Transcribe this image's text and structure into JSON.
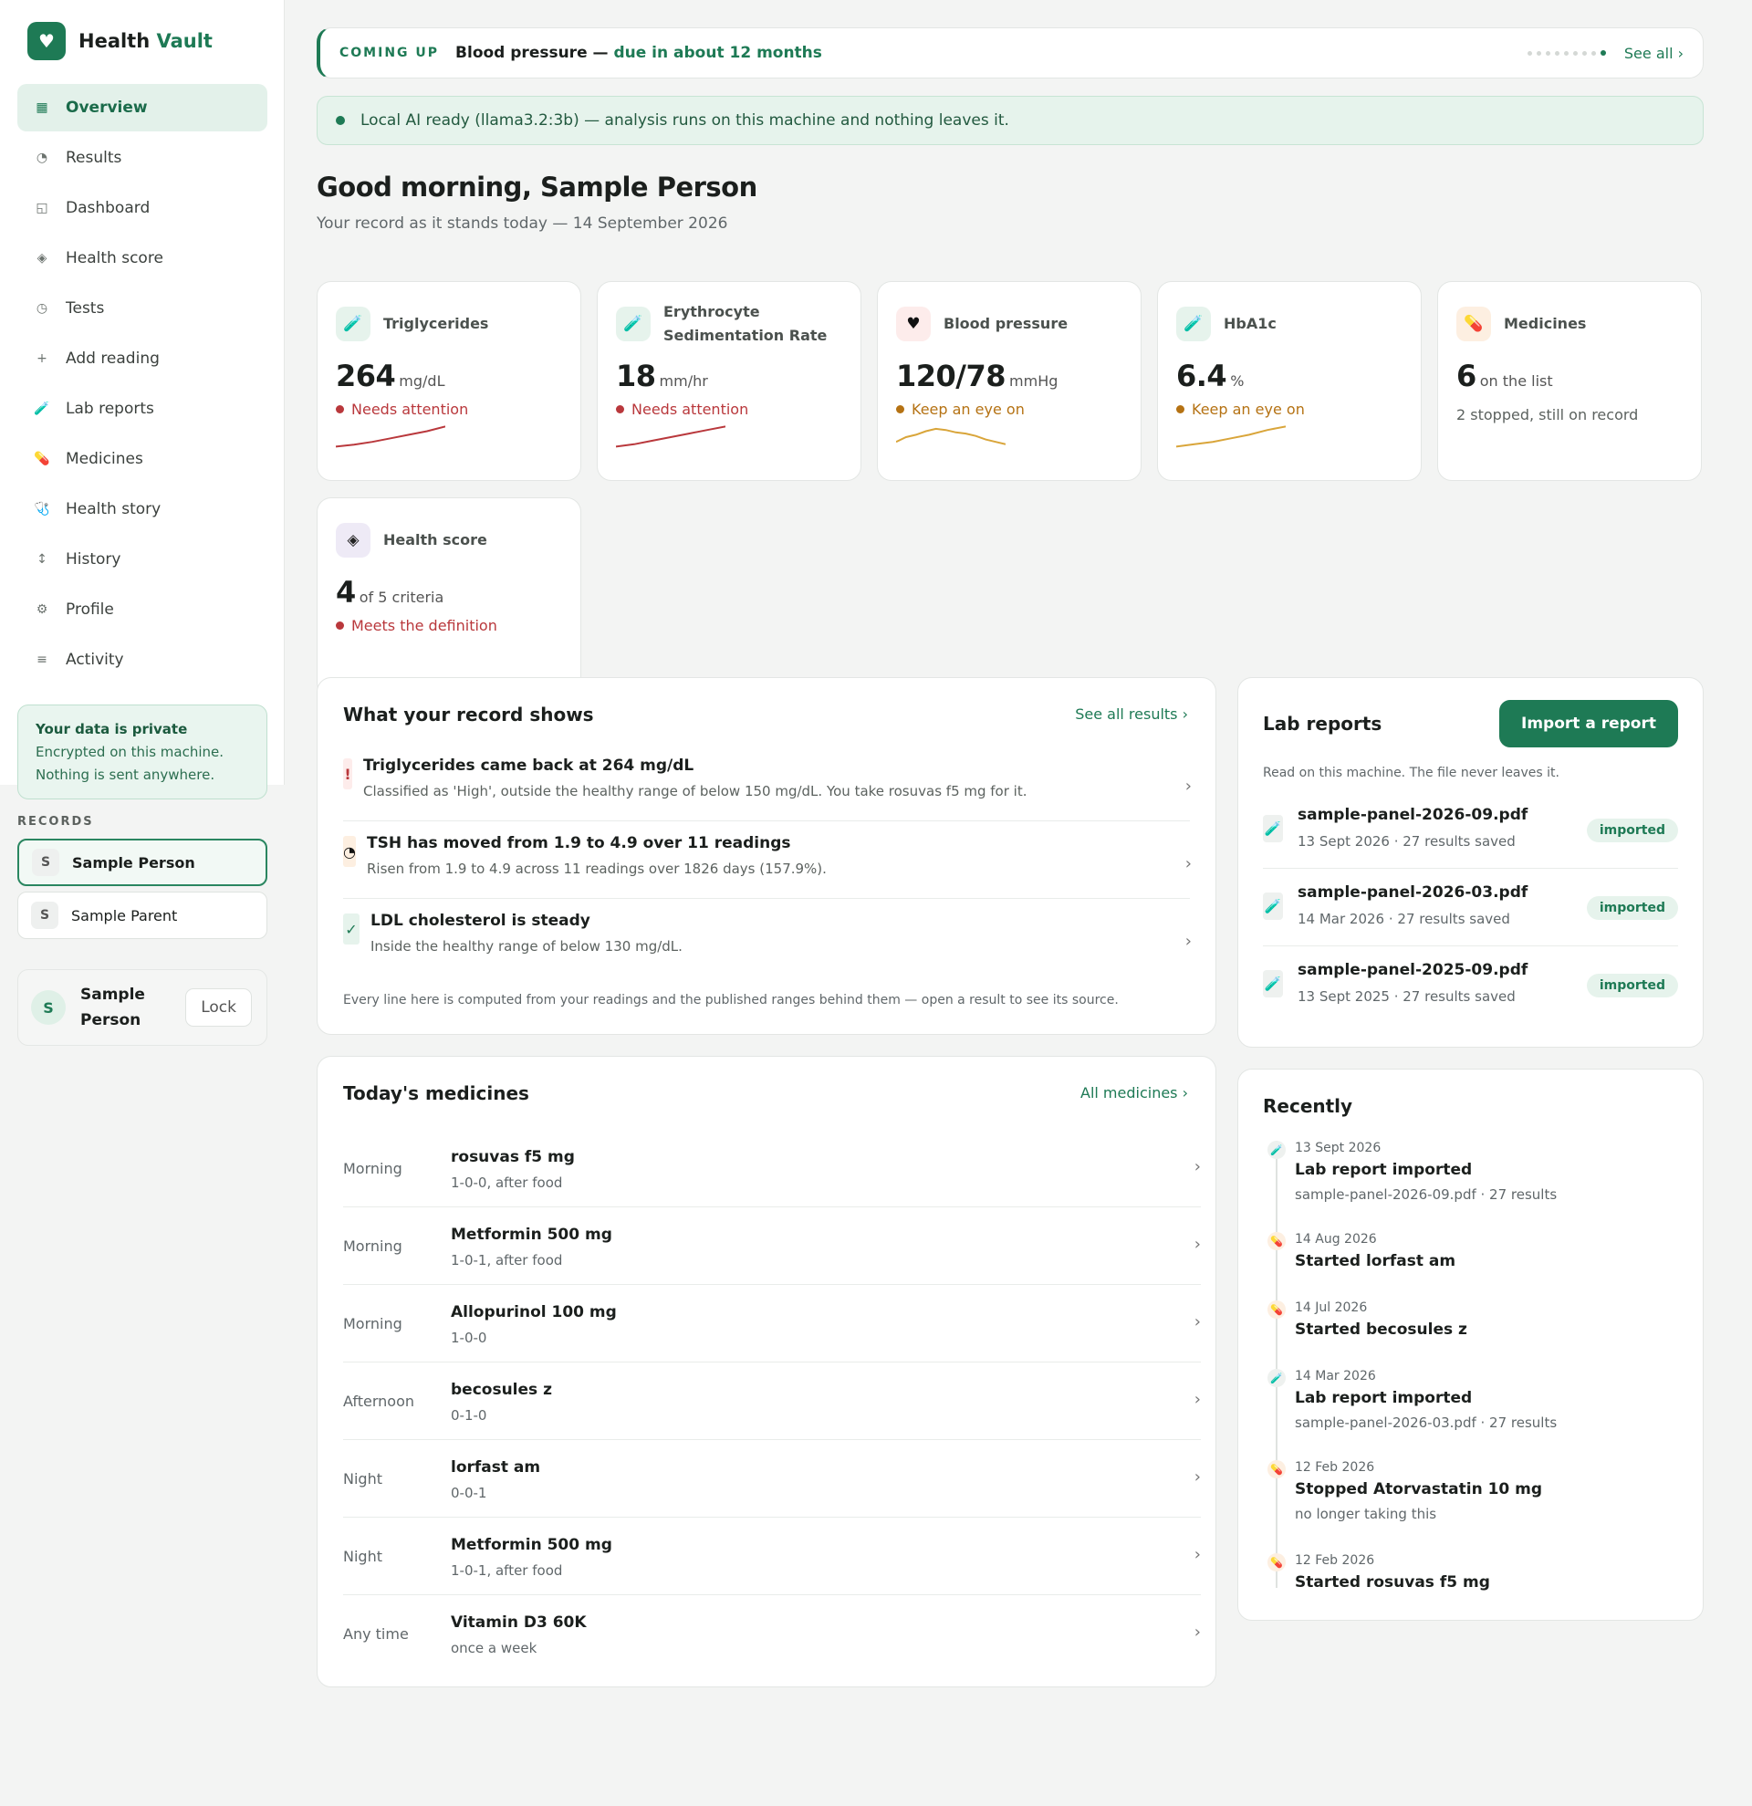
{
  "brand": {
    "name": "Health",
    "accent": "Vault"
  },
  "nav": [
    {
      "label": "Overview",
      "icon": "grid-icon",
      "glyph": "▦",
      "active": true
    },
    {
      "label": "Results",
      "icon": "pie-icon",
      "glyph": "◔"
    },
    {
      "label": "Dashboard",
      "icon": "dashboard-icon",
      "glyph": "◱"
    },
    {
      "label": "Health score",
      "icon": "diamond-icon",
      "glyph": "◈"
    },
    {
      "label": "Tests",
      "icon": "clock-icon",
      "glyph": "◷"
    },
    {
      "label": "Add reading",
      "icon": "plus-icon",
      "glyph": "+"
    },
    {
      "label": "Lab reports",
      "icon": "test-tube-icon",
      "glyph": "🧪"
    },
    {
      "label": "Medicines",
      "icon": "pill-icon",
      "glyph": "💊"
    },
    {
      "label": "Health story",
      "icon": "stethoscope-icon",
      "glyph": "🩺"
    },
    {
      "label": "History",
      "icon": "arrows-icon",
      "glyph": "↕"
    },
    {
      "label": "Profile",
      "icon": "gear-icon",
      "glyph": "⚙"
    },
    {
      "label": "Activity",
      "icon": "list-icon",
      "glyph": "≡"
    }
  ],
  "privacy": {
    "title": "Your data is private",
    "line1": "Encrypted on this machine.",
    "line2": "Nothing is sent anywhere."
  },
  "records": {
    "label": "RECORDS",
    "items": [
      {
        "initial": "S",
        "name": "Sample Person"
      },
      {
        "initial": "S",
        "name": "Sample Parent"
      }
    ]
  },
  "user": {
    "initial": "S",
    "name": "Sample Person",
    "lock": "Lock"
  },
  "coming_up": {
    "label": "COMING UP",
    "item": "Blood pressure —",
    "due": "due in about 12 months",
    "see_all": "See all ›"
  },
  "ai": {
    "text": "Local AI ready (llama3.2:3b) — analysis runs on this machine and nothing leaves it."
  },
  "greeting": {
    "title": "Good morning, Sample Person",
    "subtitle": "Your record as it stands today — 14 September 2026"
  },
  "stats": [
    {
      "title": "Triglycerides",
      "value": "264",
      "unit": "mg/dL",
      "status": "Needs attention",
      "level": "red",
      "icon": "test-tube-icon",
      "trend": [
        0.1,
        0.18,
        0.3,
        0.45,
        0.6,
        0.75,
        0.95
      ]
    },
    {
      "title": "Erythrocyte Sedimentation Rate",
      "value": "18",
      "unit": "mm/hr",
      "status": "Needs attention",
      "level": "red",
      "icon": "test-tube-icon",
      "trend": [
        0.1,
        0.2,
        0.35,
        0.5,
        0.65,
        0.8,
        0.95
      ]
    },
    {
      "title": "Blood pressure",
      "value": "120/78",
      "unit": "mmHg",
      "status": "Keep an eye on",
      "level": "amber",
      "icon": "heart-icon",
      "trend": [
        0.3,
        0.5,
        0.6,
        0.75,
        0.85,
        0.8,
        0.7,
        0.65,
        0.55,
        0.4,
        0.3,
        0.2
      ]
    },
    {
      "title": "HbA1c",
      "value": "6.4",
      "unit": "%",
      "status": "Keep an eye on",
      "level": "amber",
      "icon": "test-tube-icon",
      "trend": [
        0.1,
        0.2,
        0.3,
        0.45,
        0.6,
        0.8,
        0.95
      ]
    },
    {
      "title": "Medicines",
      "value": "6",
      "unit": "on the list",
      "sub": "2 stopped, still on record",
      "icon": "pill-icon"
    },
    {
      "title": "Health score",
      "value": "4",
      "unit": "of 5 criteria",
      "status": "Meets the definition",
      "level": "red",
      "icon": "diamond-icon"
    }
  ],
  "record_shows": {
    "title": "What your record shows",
    "link": "See all results ›",
    "items": [
      {
        "badge": "!",
        "title": "Triglycerides came back at 264 mg/dL",
        "sub": "Classified as 'High', outside the healthy range of below 150 mg/dL. You take rosuvas f5 mg for it."
      },
      {
        "badge": "◔",
        "title": "TSH has moved from 1.9 to 4.9 over 11 readings",
        "sub": "Risen from 1.9 to 4.9 across 11 readings over 1826 days (157.9%)."
      },
      {
        "badge": "✓",
        "title": "LDL cholesterol is steady",
        "sub": "Inside the healthy range of below 130 mg/dL."
      }
    ],
    "footer": "Every line here is computed from your readings and the published ranges behind them — open a result to see its source."
  },
  "medicines": {
    "title": "Today's medicines",
    "link": "All medicines ›",
    "items": [
      {
        "time": "Morning",
        "name": "rosuvas f5 mg",
        "dose": "1-0-0, after food"
      },
      {
        "time": "Morning",
        "name": "Metformin 500 mg",
        "dose": "1-0-1, after food"
      },
      {
        "time": "Morning",
        "name": "Allopurinol 100 mg",
        "dose": "1-0-0"
      },
      {
        "time": "Afternoon",
        "name": "becosules z",
        "dose": "0-1-0"
      },
      {
        "time": "Night",
        "name": "lorfast am",
        "dose": "0-0-1"
      },
      {
        "time": "Night",
        "name": "Metformin 500 mg",
        "dose": "1-0-1, after food"
      },
      {
        "time": "Any time",
        "name": "Vitamin D3 60K",
        "dose": "once a week"
      }
    ]
  },
  "lab_reports": {
    "title": "Lab reports",
    "button": "Import a report",
    "note": "Read on this machine. The file never leaves it.",
    "items": [
      {
        "name": "sample-panel-2026-09.pdf",
        "meta": "13 Sept 2026 · 27 results saved",
        "badge": "imported"
      },
      {
        "name": "sample-panel-2026-03.pdf",
        "meta": "14 Mar 2026 · 27 results saved",
        "badge": "imported"
      },
      {
        "name": "sample-panel-2025-09.pdf",
        "meta": "13 Sept 2025 · 27 results saved",
        "badge": "imported"
      }
    ]
  },
  "recently": {
    "title": "Recently",
    "items": [
      {
        "type": "lab",
        "date": "13 Sept 2026",
        "title": "Lab report imported",
        "sub": "sample-panel-2026-09.pdf · 27 results"
      },
      {
        "type": "pill",
        "date": "14 Aug 2026",
        "title": "Started lorfast am",
        "sub": ""
      },
      {
        "type": "pill",
        "date": "14 Jul 2026",
        "title": "Started becosules z",
        "sub": ""
      },
      {
        "type": "lab",
        "date": "14 Mar 2026",
        "title": "Lab report imported",
        "sub": "sample-panel-2026-03.pdf · 27 results"
      },
      {
        "type": "pill",
        "date": "12 Feb 2026",
        "title": "Stopped Atorvastatin 10 mg",
        "sub": "no longer taking this"
      },
      {
        "type": "pill",
        "date": "12 Feb 2026",
        "title": "Started rosuvas f5 mg",
        "sub": ""
      }
    ]
  },
  "colors": {
    "accent": "#1e7a55",
    "attention": "#b9383c",
    "watch": "#b57213"
  }
}
